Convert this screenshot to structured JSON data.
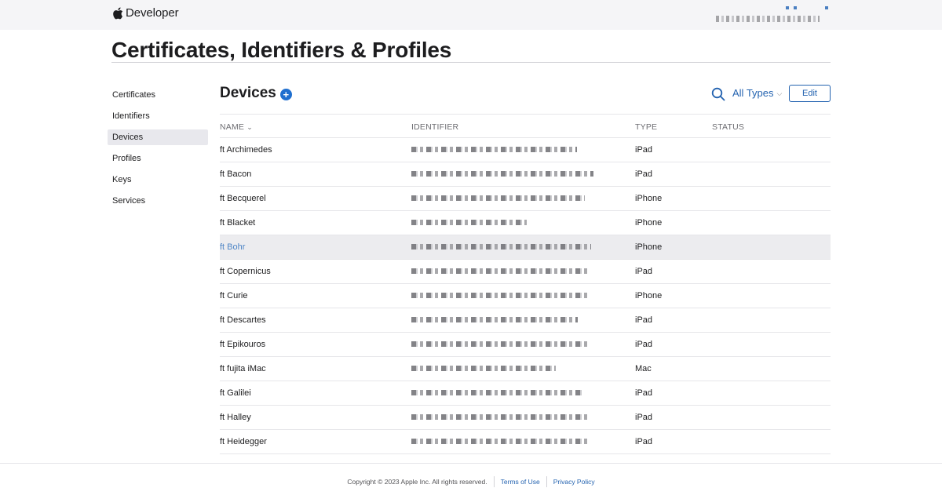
{
  "header": {
    "brand_label": "Developer",
    "logo_icon": "apple-logo-icon"
  },
  "page": {
    "title": "Certificates, Identifiers & Profiles"
  },
  "sidebar": {
    "items": [
      {
        "label": "Certificates"
      },
      {
        "label": "Identifiers"
      },
      {
        "label": "Devices",
        "active": true
      },
      {
        "label": "Profiles"
      },
      {
        "label": "Keys"
      },
      {
        "label": "Services"
      }
    ]
  },
  "section": {
    "title": "Devices",
    "add_icon_glyph": "+",
    "filter_label": "All Types",
    "filter_chevron": "⌵",
    "edit_label": "Edit"
  },
  "table": {
    "columns": {
      "name": "NAME",
      "name_sort": "⌄",
      "identifier": "IDENTIFIER",
      "type": "TYPE",
      "status": "STATUS"
    },
    "rows": [
      {
        "name": "ft Archimedes",
        "type": "iPad"
      },
      {
        "name": "ft Bacon",
        "type": "iPad"
      },
      {
        "name": "ft Becquerel",
        "type": "iPhone"
      },
      {
        "name": "ft Blacket",
        "type": "iPhone"
      },
      {
        "name": "ft Bohr",
        "type": "iPhone",
        "hovered": true
      },
      {
        "name": "ft Copernicus",
        "type": "iPad"
      },
      {
        "name": "ft Curie",
        "type": "iPhone"
      },
      {
        "name": "ft Descartes",
        "type": "iPad"
      },
      {
        "name": "ft Epikouros",
        "type": "iPad"
      },
      {
        "name": "ft fujita iMac",
        "type": "Mac"
      },
      {
        "name": "ft Galilei",
        "type": "iPad"
      },
      {
        "name": "ft Halley",
        "type": "iPad"
      },
      {
        "name": "ft Heidegger",
        "type": "iPad"
      }
    ]
  },
  "footer": {
    "copyright": "Copyright © 2023 Apple Inc. All rights reserved.",
    "terms": "Terms of Use",
    "privacy": "Privacy Policy"
  },
  "colors": {
    "accent": "#2463b0",
    "plus_button": "#1f6fcf",
    "hover_row": "#ececef",
    "hover_link": "#4f86c6"
  }
}
